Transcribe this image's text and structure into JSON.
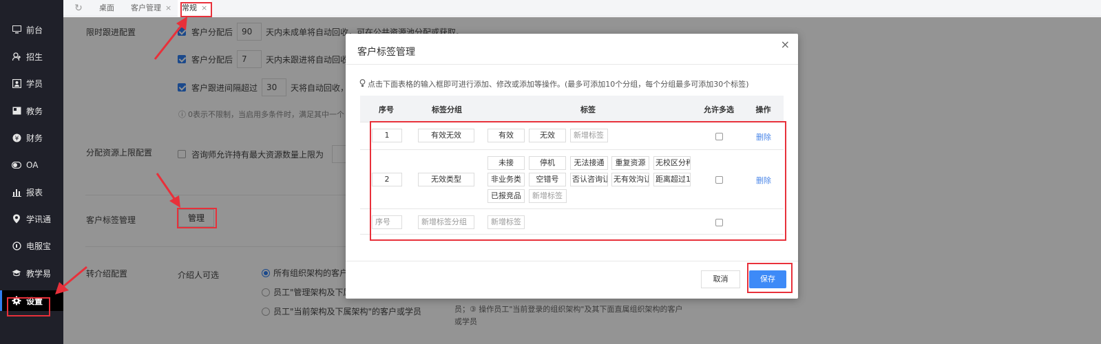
{
  "sidebar": {
    "items": [
      {
        "label": "前台",
        "icon": "monitor-icon"
      },
      {
        "label": "招生",
        "icon": "user-plus-icon"
      },
      {
        "label": "学员",
        "icon": "id-card-icon"
      },
      {
        "label": "教务",
        "icon": "book-icon"
      },
      {
        "label": "财务",
        "icon": "yen-icon"
      },
      {
        "label": "OA",
        "icon": "toggle-icon"
      },
      {
        "label": "报表",
        "icon": "bar-chart-icon"
      },
      {
        "label": "学讯通",
        "icon": "location-icon"
      },
      {
        "label": "电服宝",
        "icon": "phone-icon"
      },
      {
        "label": "教学易",
        "icon": "graduation-icon"
      },
      {
        "label": "设置",
        "icon": "gear-icon"
      }
    ]
  },
  "tabs": [
    {
      "label": "桌面",
      "closable": false
    },
    {
      "label": "客户管理",
      "closable": true
    },
    {
      "label": "常规",
      "closable": true
    }
  ],
  "background": {
    "section1_label": "限时跟进配置",
    "rule1_prefix": "客户分配后",
    "rule1_value": "90",
    "rule1_suffix": "天内未成单将自动回收，可在公共资源池分配或获取。",
    "rule2_prefix": "客户分配后",
    "rule2_value": "7",
    "rule2_suffix": "天内未跟进将自动回收，",
    "rule3_prefix": "客户跟进间隔超过",
    "rule3_value": "30",
    "rule3_suffix": "天将自动回收，可",
    "hint": "0表示不限制，当启用多条件时，满足其中一个",
    "section2_label": "分配资源上限配置",
    "limit_text": "咨询师允许持有最大资源数量上限为",
    "section3_label": "客户标签管理",
    "manage_button": "管理",
    "section4_label": "转介绍配置",
    "referrer_label": "介绍人可选",
    "radio1": "所有组织架构的客户或",
    "radio2": "员工\"管理架构及下属架",
    "radio3": "员工\"当前架构及下属架构\"的客户或学员",
    "note_line1": "员；③ 操作员工\"当前登录的组织架构\"及其下面直属组织架构的客户",
    "note_line2": "或学员"
  },
  "modal": {
    "title": "客户标签管理",
    "close": "×",
    "tip": "点击下面表格的输入框即可进行添加、修改或添加等操作。(最多可添加10个分组，每个分组最多可添加30个标签)",
    "headers": {
      "index": "序号",
      "group": "标签分组",
      "tags": "标签",
      "multi": "允许多选",
      "action": "操作"
    },
    "rows": [
      {
        "index": "1",
        "group": "有效无效",
        "tags": [
          "有效",
          "无效"
        ],
        "new_tag": "新增标签",
        "action": "删除"
      },
      {
        "index": "2",
        "group": "无效类型",
        "tags": [
          "未接",
          "停机",
          "无法接通",
          "重复资源",
          "无校区分秤",
          "非业务类",
          "空错号",
          "否认咨询让",
          "无有效沟让",
          "距离超过1",
          "已报竞品"
        ],
        "new_tag": "新增标签",
        "action": "删除"
      }
    ],
    "new_row": {
      "index_placeholder": "序号",
      "group_placeholder": "新增标签分组",
      "tag_placeholder": "新增标签"
    },
    "cancel": "取消",
    "save": "保存"
  },
  "colors": {
    "sidebar_bg": "#1f2029",
    "accent": "#3d8af7",
    "highlight": "#e8303a",
    "link": "#4a86e8"
  }
}
